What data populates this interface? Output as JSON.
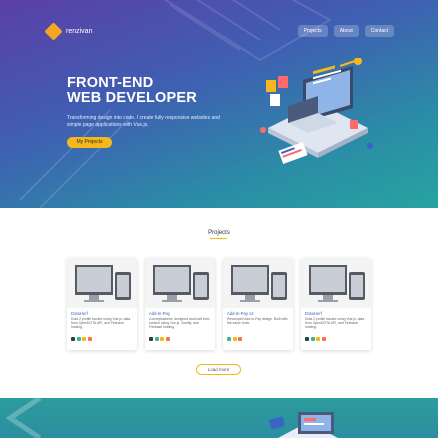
{
  "brand": {
    "name": "renzivan"
  },
  "nav": {
    "links": [
      "Projects",
      "About",
      "Contact"
    ]
  },
  "hero": {
    "title_line1": "FRONT-END",
    "title_line2": "WEB DEVELOPER",
    "subtitle": "Transforming design into code. I create fully responsive websites and simple page applications with Vue.js.",
    "cta_label": "My Projects"
  },
  "projects": {
    "heading": "Projects",
    "load_more_label": "Load more",
    "items": [
      {
        "title": "DotaHerf",
        "desc": "Dota 2 profile tracker using Vue.js, data from OpenDOTA API, and Firebase hosting."
      },
      {
        "title": "Add-In-Pay",
        "desc": "Conceptualized, designed and built from scratch using Vue.js, Vuetify, and Firebase hosting."
      },
      {
        "title": "Add-In-Pay v2",
        "desc": "Revamped Add-In-Pay design. Built with the same tools."
      },
      {
        "title": "DotaHerf",
        "desc": "Dota 2 profile tracker using Vue.js, data from OpenDOTA API, and Firebase hosting."
      }
    ]
  },
  "colors": {
    "accent": "#f5b81c",
    "link": "#3b63c4",
    "hero_start": "#5b3fa8",
    "hero_end": "#27a3a0"
  }
}
